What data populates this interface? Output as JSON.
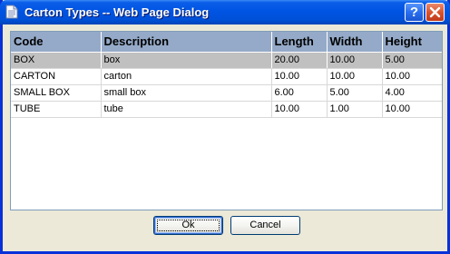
{
  "window": {
    "title": "Carton Types -- Web Page Dialog",
    "help_label": "?"
  },
  "grid": {
    "columns": [
      "Code",
      "Description",
      "Length",
      "Width",
      "Height"
    ],
    "rows": [
      {
        "code": "BOX",
        "description": "box",
        "length": "20.00",
        "width": "10.00",
        "height": "5.00"
      },
      {
        "code": "CARTON",
        "description": "carton",
        "length": "10.00",
        "width": "10.00",
        "height": "10.00"
      },
      {
        "code": "SMALL BOX",
        "description": "small box",
        "length": "6.00",
        "width": "5.00",
        "height": "4.00"
      },
      {
        "code": "TUBE",
        "description": "tube",
        "length": "10.00",
        "width": "1.00",
        "height": "10.00"
      }
    ],
    "selected_row": 0
  },
  "buttons": {
    "ok_label": "Ok",
    "cancel_label": "Cancel"
  },
  "colors": {
    "titlebar": "#0054e3",
    "header_bg": "#95aac8",
    "selected_row_bg": "#c0c0c0",
    "window_bg": "#ece9d8"
  }
}
